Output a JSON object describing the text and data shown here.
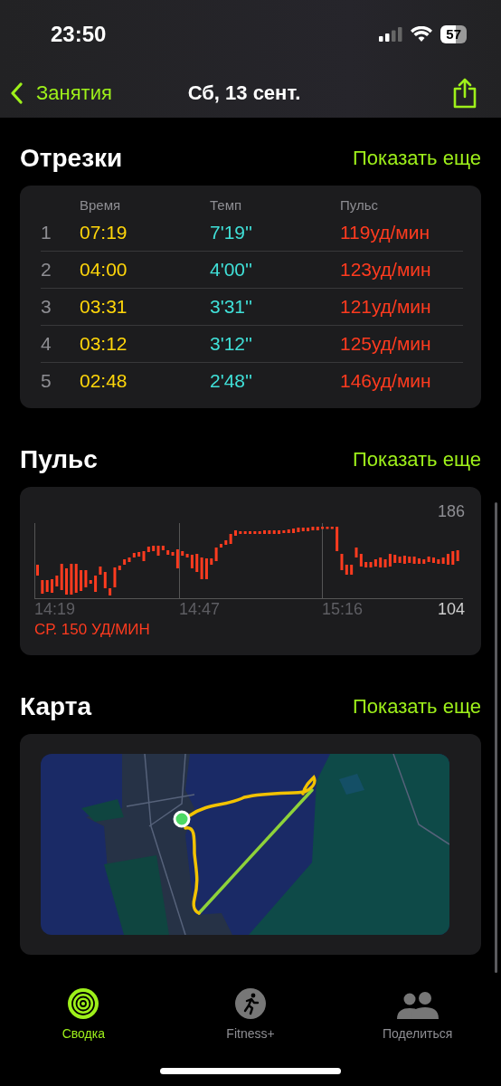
{
  "status_bar": {
    "time": "23:50",
    "battery": "57"
  },
  "nav": {
    "back": "Занятия",
    "title": "Сб, 13 сент."
  },
  "splits": {
    "title": "Отрезки",
    "more": "Показать еще",
    "columns": [
      "Время",
      "Темп",
      "Пульс"
    ],
    "rows": [
      {
        "index": "1",
        "time": "07:19",
        "pace": "7'19''",
        "pulse": "119уд/мин"
      },
      {
        "index": "2",
        "time": "04:00",
        "pace": "4'00''",
        "pulse": "123уд/мин"
      },
      {
        "index": "3",
        "time": "03:31",
        "pace": "3'31''",
        "pulse": "121уд/мин"
      },
      {
        "index": "4",
        "time": "03:12",
        "pace": "3'12''",
        "pulse": "125уд/мин"
      },
      {
        "index": "5",
        "time": "02:48",
        "pace": "2'48''",
        "pulse": "146уд/мин"
      }
    ]
  },
  "heart_rate": {
    "title": "Пульс",
    "more": "Показать еще",
    "max": "186",
    "min": "104",
    "times": [
      "14:19",
      "14:47",
      "15:16"
    ],
    "average": "СР. 150 УД/МИН"
  },
  "map": {
    "title": "Карта",
    "more": "Показать еще",
    "kind": "picture"
  },
  "tabs": [
    {
      "label": "Сводка",
      "selected": true,
      "kind": "rings"
    },
    {
      "label": "Fitness+",
      "selected": false,
      "kind": "runner"
    },
    {
      "label": "Поделиться",
      "selected": false,
      "kind": "people"
    }
  ]
}
